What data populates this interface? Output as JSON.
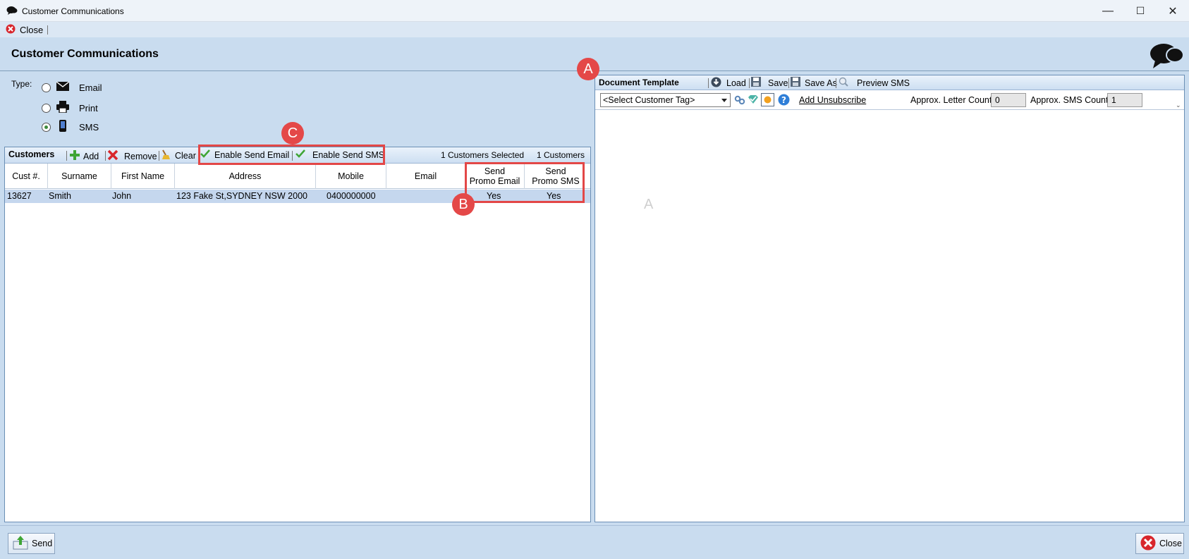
{
  "window": {
    "title": "Customer Communications",
    "min": "—",
    "max": "☐",
    "close": "✕"
  },
  "topbar": {
    "close_label": "Close"
  },
  "header": {
    "title": "Customer Communications"
  },
  "type": {
    "label": "Type:",
    "options": [
      {
        "label": "Email",
        "selected": false
      },
      {
        "label": "Print",
        "selected": false
      },
      {
        "label": "SMS",
        "selected": true
      }
    ]
  },
  "customers": {
    "title": "Customers",
    "add": "Add",
    "remove": "Remove",
    "clear": "Clear",
    "enable_email": "Enable Send Email",
    "enable_sms": "Enable Send SMS",
    "selected_count": "1 Customers Selected",
    "total_count": "1 Customers",
    "columns": [
      "Cust #.",
      "Surname",
      "First Name",
      "Address",
      "Mobile",
      "Email",
      "Send\nPromo Email",
      "Send\nPromo SMS"
    ],
    "rows": [
      {
        "cust": "13627",
        "surname": "Smith",
        "first": "John",
        "address": "123 Fake St,SYDNEY NSW 2000",
        "mobile": "0400000000",
        "email": "",
        "promo_email": "Yes",
        "promo_sms": "Yes"
      }
    ]
  },
  "template": {
    "title": "Document Template",
    "load": "Load",
    "save": "Save",
    "save_as": "Save As",
    "preview": "Preview SMS",
    "tag_select": "<Select Customer Tag>",
    "unsubscribe": "Add Unsubscribe",
    "letter_count_label": "Approx. Letter Count",
    "letter_count": "0",
    "sms_count_label": "Approx. SMS Count",
    "sms_count": "1",
    "watermark": "A"
  },
  "footer": {
    "send": "Send",
    "close": "Close"
  },
  "annotations": {
    "a": "A",
    "b": "B",
    "c": "C"
  },
  "colors": {
    "accent": "#e44848",
    "selection": "#c5d7ee",
    "panel": "#c9dcef"
  }
}
